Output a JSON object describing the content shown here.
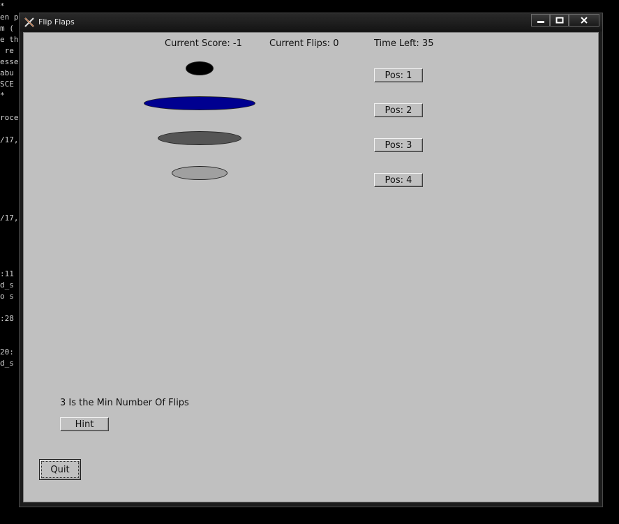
{
  "terminal": {
    "lines": [
      "*",
      "en p",
      "m (",
      "e th",
      " re",
      "esse",
      "abu",
      "SCE",
      "*",
      "",
      "roce",
      "",
      "/17,",
      "",
      "",
      "",
      "",
      "",
      "",
      "/17,",
      "",
      "",
      "",
      "",
      "",
      ":11",
      "d_s",
      "o s",
      "",
      ":28",
      "",
      "",
      "20:",
      "d_s"
    ]
  },
  "window": {
    "title": "Flip Flaps",
    "controls": {
      "minimize": "minimize",
      "maximize": "maximize",
      "close": "close"
    }
  },
  "game": {
    "score_label": "Current Score: -1",
    "flips_label": "Current Flips: 0",
    "time_label": "Time Left: 35",
    "pos_buttons": [
      "Pos: 1",
      "Pos: 2",
      "Pos: 3",
      "Pos: 4"
    ],
    "discs": [
      {
        "color": "#000000",
        "size_rank": 1
      },
      {
        "color": "#000090",
        "size_rank": 4
      },
      {
        "color": "#555555",
        "size_rank": 3
      },
      {
        "color": "#a0a0a0",
        "size_rank": 2
      }
    ],
    "min_flips_text": "3 Is the Min Number Of Flips",
    "hint_label": "Hint",
    "quit_label": "Quit"
  }
}
